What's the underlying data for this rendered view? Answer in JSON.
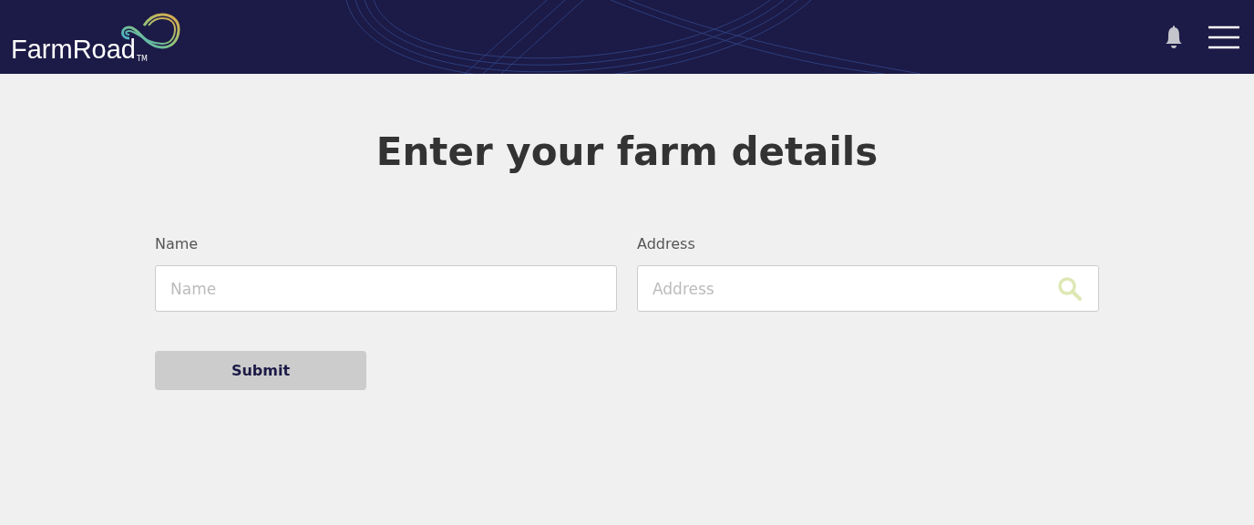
{
  "header": {
    "logo": {
      "name": "FarmRoad",
      "mark": "TM"
    }
  },
  "title": "Enter your farm details",
  "fields": [
    {
      "label": "Name",
      "placeholder": "Name",
      "kind": "text"
    },
    {
      "label": "Address",
      "placeholder": "Address",
      "kind": "search"
    }
  ],
  "submit": {
    "label": "Submit",
    "disabled": true
  }
}
